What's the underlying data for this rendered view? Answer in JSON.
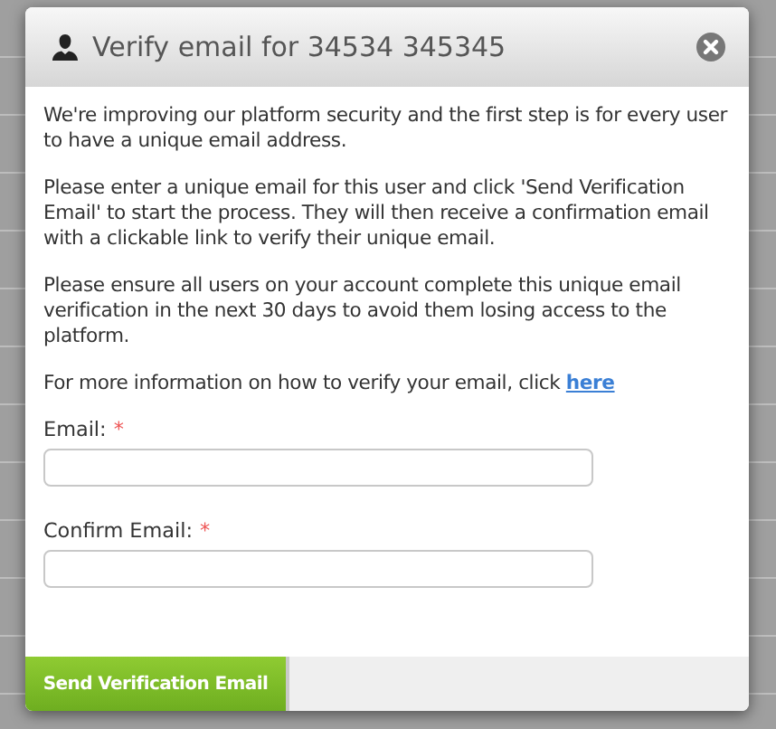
{
  "dialog": {
    "title": "Verify email for 34534 345345",
    "paragraphs": [
      "We're improving our platform security and the first step is for every user to have a unique email address.",
      "Please enter a unique email for this user and click 'Send Verification Email' to start the process. They will then receive a confirmation email with a clickable link to verify their unique email.",
      "Please ensure all users on your account complete this unique email verification in the next 30 days to avoid them losing access to the platform."
    ],
    "info": {
      "text": "For more information on how to verify your email, click",
      "link": "here"
    },
    "fields": [
      {
        "label": "Email:",
        "required": "*"
      },
      {
        "label": "Confirm Email:",
        "required": "*"
      }
    ],
    "button": "Send Verification Email"
  }
}
